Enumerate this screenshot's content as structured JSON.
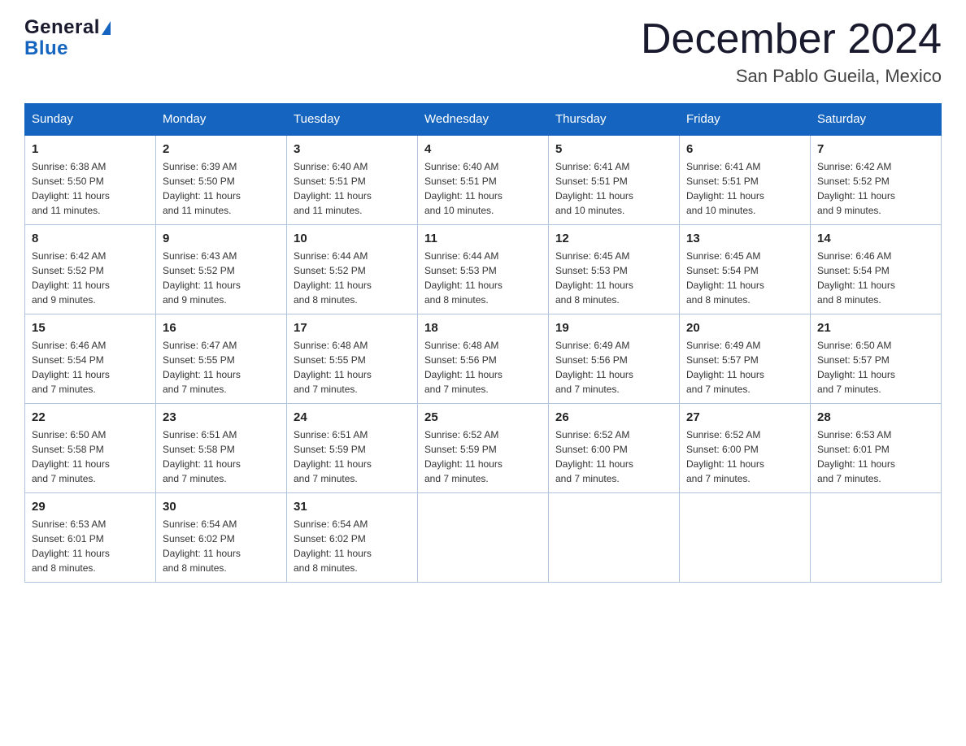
{
  "header": {
    "logo_general": "General",
    "logo_blue": "Blue",
    "month_title": "December 2024",
    "location": "San Pablo Gueila, Mexico"
  },
  "days_of_week": [
    "Sunday",
    "Monday",
    "Tuesday",
    "Wednesday",
    "Thursday",
    "Friday",
    "Saturday"
  ],
  "weeks": [
    [
      {
        "day": "1",
        "sunrise": "6:38 AM",
        "sunset": "5:50 PM",
        "daylight": "11 hours and 11 minutes."
      },
      {
        "day": "2",
        "sunrise": "6:39 AM",
        "sunset": "5:50 PM",
        "daylight": "11 hours and 11 minutes."
      },
      {
        "day": "3",
        "sunrise": "6:40 AM",
        "sunset": "5:51 PM",
        "daylight": "11 hours and 11 minutes."
      },
      {
        "day": "4",
        "sunrise": "6:40 AM",
        "sunset": "5:51 PM",
        "daylight": "11 hours and 10 minutes."
      },
      {
        "day": "5",
        "sunrise": "6:41 AM",
        "sunset": "5:51 PM",
        "daylight": "11 hours and 10 minutes."
      },
      {
        "day": "6",
        "sunrise": "6:41 AM",
        "sunset": "5:51 PM",
        "daylight": "11 hours and 10 minutes."
      },
      {
        "day": "7",
        "sunrise": "6:42 AM",
        "sunset": "5:52 PM",
        "daylight": "11 hours and 9 minutes."
      }
    ],
    [
      {
        "day": "8",
        "sunrise": "6:42 AM",
        "sunset": "5:52 PM",
        "daylight": "11 hours and 9 minutes."
      },
      {
        "day": "9",
        "sunrise": "6:43 AM",
        "sunset": "5:52 PM",
        "daylight": "11 hours and 9 minutes."
      },
      {
        "day": "10",
        "sunrise": "6:44 AM",
        "sunset": "5:52 PM",
        "daylight": "11 hours and 8 minutes."
      },
      {
        "day": "11",
        "sunrise": "6:44 AM",
        "sunset": "5:53 PM",
        "daylight": "11 hours and 8 minutes."
      },
      {
        "day": "12",
        "sunrise": "6:45 AM",
        "sunset": "5:53 PM",
        "daylight": "11 hours and 8 minutes."
      },
      {
        "day": "13",
        "sunrise": "6:45 AM",
        "sunset": "5:54 PM",
        "daylight": "11 hours and 8 minutes."
      },
      {
        "day": "14",
        "sunrise": "6:46 AM",
        "sunset": "5:54 PM",
        "daylight": "11 hours and 8 minutes."
      }
    ],
    [
      {
        "day": "15",
        "sunrise": "6:46 AM",
        "sunset": "5:54 PM",
        "daylight": "11 hours and 7 minutes."
      },
      {
        "day": "16",
        "sunrise": "6:47 AM",
        "sunset": "5:55 PM",
        "daylight": "11 hours and 7 minutes."
      },
      {
        "day": "17",
        "sunrise": "6:48 AM",
        "sunset": "5:55 PM",
        "daylight": "11 hours and 7 minutes."
      },
      {
        "day": "18",
        "sunrise": "6:48 AM",
        "sunset": "5:56 PM",
        "daylight": "11 hours and 7 minutes."
      },
      {
        "day": "19",
        "sunrise": "6:49 AM",
        "sunset": "5:56 PM",
        "daylight": "11 hours and 7 minutes."
      },
      {
        "day": "20",
        "sunrise": "6:49 AM",
        "sunset": "5:57 PM",
        "daylight": "11 hours and 7 minutes."
      },
      {
        "day": "21",
        "sunrise": "6:50 AM",
        "sunset": "5:57 PM",
        "daylight": "11 hours and 7 minutes."
      }
    ],
    [
      {
        "day": "22",
        "sunrise": "6:50 AM",
        "sunset": "5:58 PM",
        "daylight": "11 hours and 7 minutes."
      },
      {
        "day": "23",
        "sunrise": "6:51 AM",
        "sunset": "5:58 PM",
        "daylight": "11 hours and 7 minutes."
      },
      {
        "day": "24",
        "sunrise": "6:51 AM",
        "sunset": "5:59 PM",
        "daylight": "11 hours and 7 minutes."
      },
      {
        "day": "25",
        "sunrise": "6:52 AM",
        "sunset": "5:59 PM",
        "daylight": "11 hours and 7 minutes."
      },
      {
        "day": "26",
        "sunrise": "6:52 AM",
        "sunset": "6:00 PM",
        "daylight": "11 hours and 7 minutes."
      },
      {
        "day": "27",
        "sunrise": "6:52 AM",
        "sunset": "6:00 PM",
        "daylight": "11 hours and 7 minutes."
      },
      {
        "day": "28",
        "sunrise": "6:53 AM",
        "sunset": "6:01 PM",
        "daylight": "11 hours and 7 minutes."
      }
    ],
    [
      {
        "day": "29",
        "sunrise": "6:53 AM",
        "sunset": "6:01 PM",
        "daylight": "11 hours and 8 minutes."
      },
      {
        "day": "30",
        "sunrise": "6:54 AM",
        "sunset": "6:02 PM",
        "daylight": "11 hours and 8 minutes."
      },
      {
        "day": "31",
        "sunrise": "6:54 AM",
        "sunset": "6:02 PM",
        "daylight": "11 hours and 8 minutes."
      },
      null,
      null,
      null,
      null
    ]
  ],
  "labels": {
    "sunrise": "Sunrise:",
    "sunset": "Sunset:",
    "daylight": "Daylight:"
  }
}
